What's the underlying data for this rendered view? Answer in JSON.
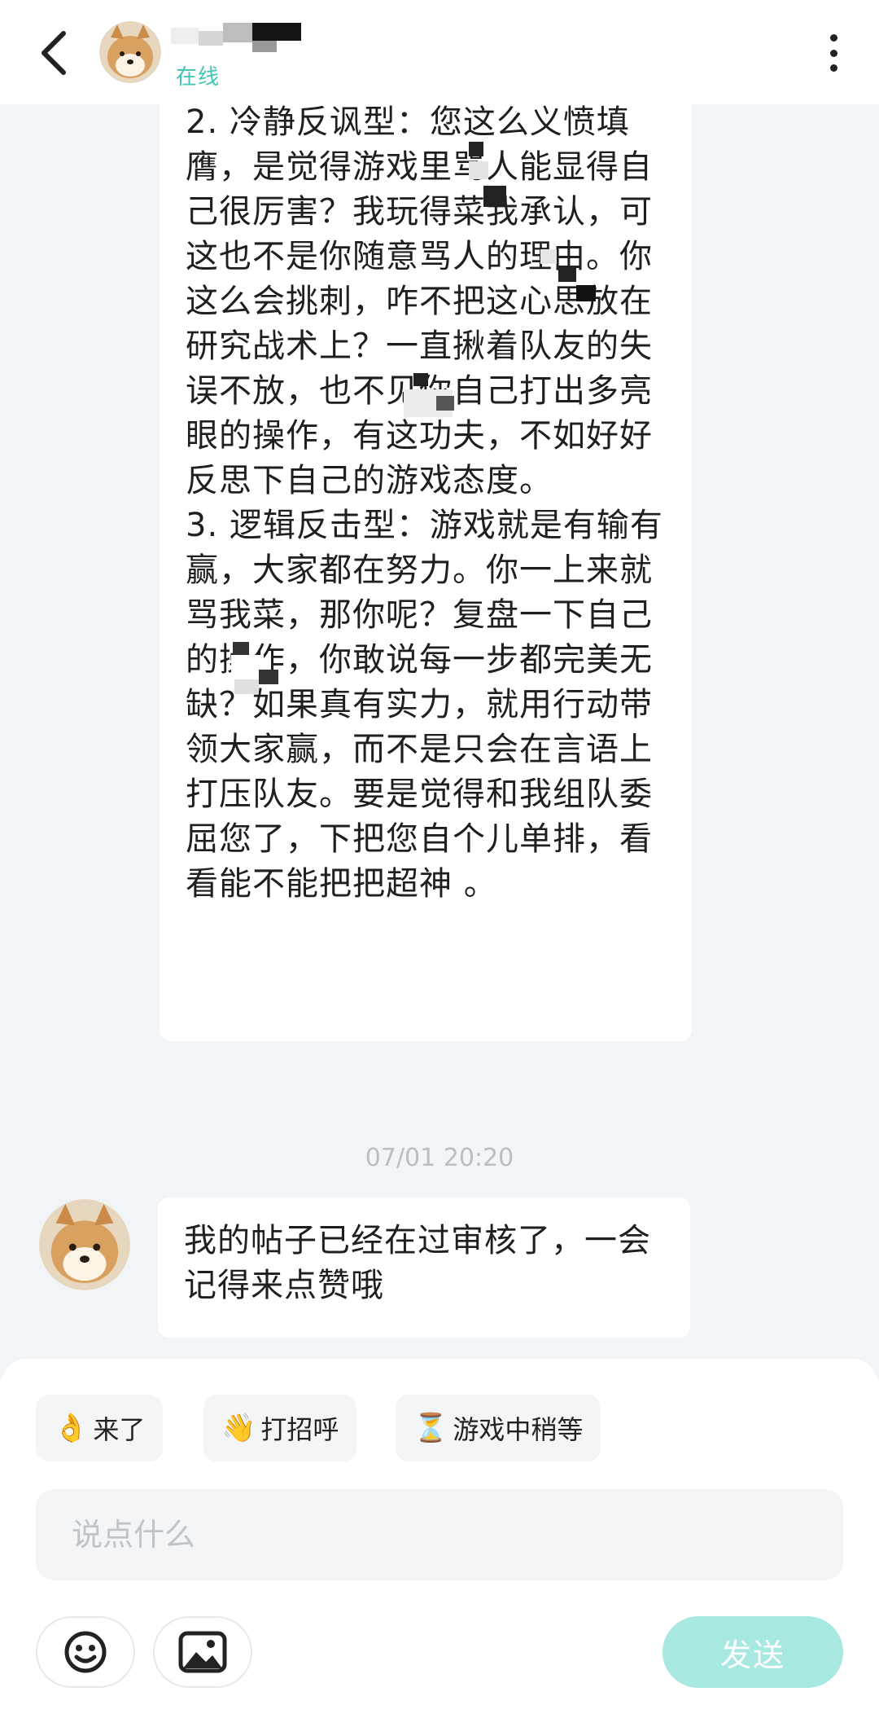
{
  "header": {
    "status": "在线"
  },
  "long_message": {
    "text": "骂我已赢不了游戏，不是吗？\n2. 冷静反讽型：您这么义愤填膺，是觉得游戏里骂人能显得自己很厉害？我玩得菜我承认，可这也不是你随意骂人的理由。你这么会挑刺，咋不把这心思放在研究战术上？一直揪着队友的失误不放，也不见你自己打出多亮眼的操作，有这功夫，不如好好反思下自己的游戏态度。\n3. 逻辑反击型：游戏就是有输有赢，大家都在努力。你一上来就骂我菜，那你呢？复盘一下自己的操作，你敢说每一步都完美无缺？如果真有实力，就用行动带领大家赢，而不是只会在言语上打压队友。要是觉得和我组队委屈您了，下把您自个儿单排，看看能不能把把超神 。"
  },
  "timestamp": "07/01 20:20",
  "short_message": {
    "text": "我的帖子已经在过审核了，一会记得来点赞哦"
  },
  "quick_replies": [
    {
      "emoji": "👌",
      "label": "来了"
    },
    {
      "emoji": "👋",
      "label": "打招呼"
    },
    {
      "emoji": "⏳",
      "label": "游戏中稍等"
    }
  ],
  "input": {
    "placeholder": "说点什么",
    "value": ""
  },
  "send_label": "发送",
  "icons": {
    "back": "chevron-left-icon",
    "more": "more-vertical-icon",
    "emoji": "smiley-icon",
    "image": "image-icon"
  },
  "colors": {
    "accent": "#3ec6b4",
    "send_disabled": "#a7e9e1",
    "background": "#f2f5f7"
  }
}
